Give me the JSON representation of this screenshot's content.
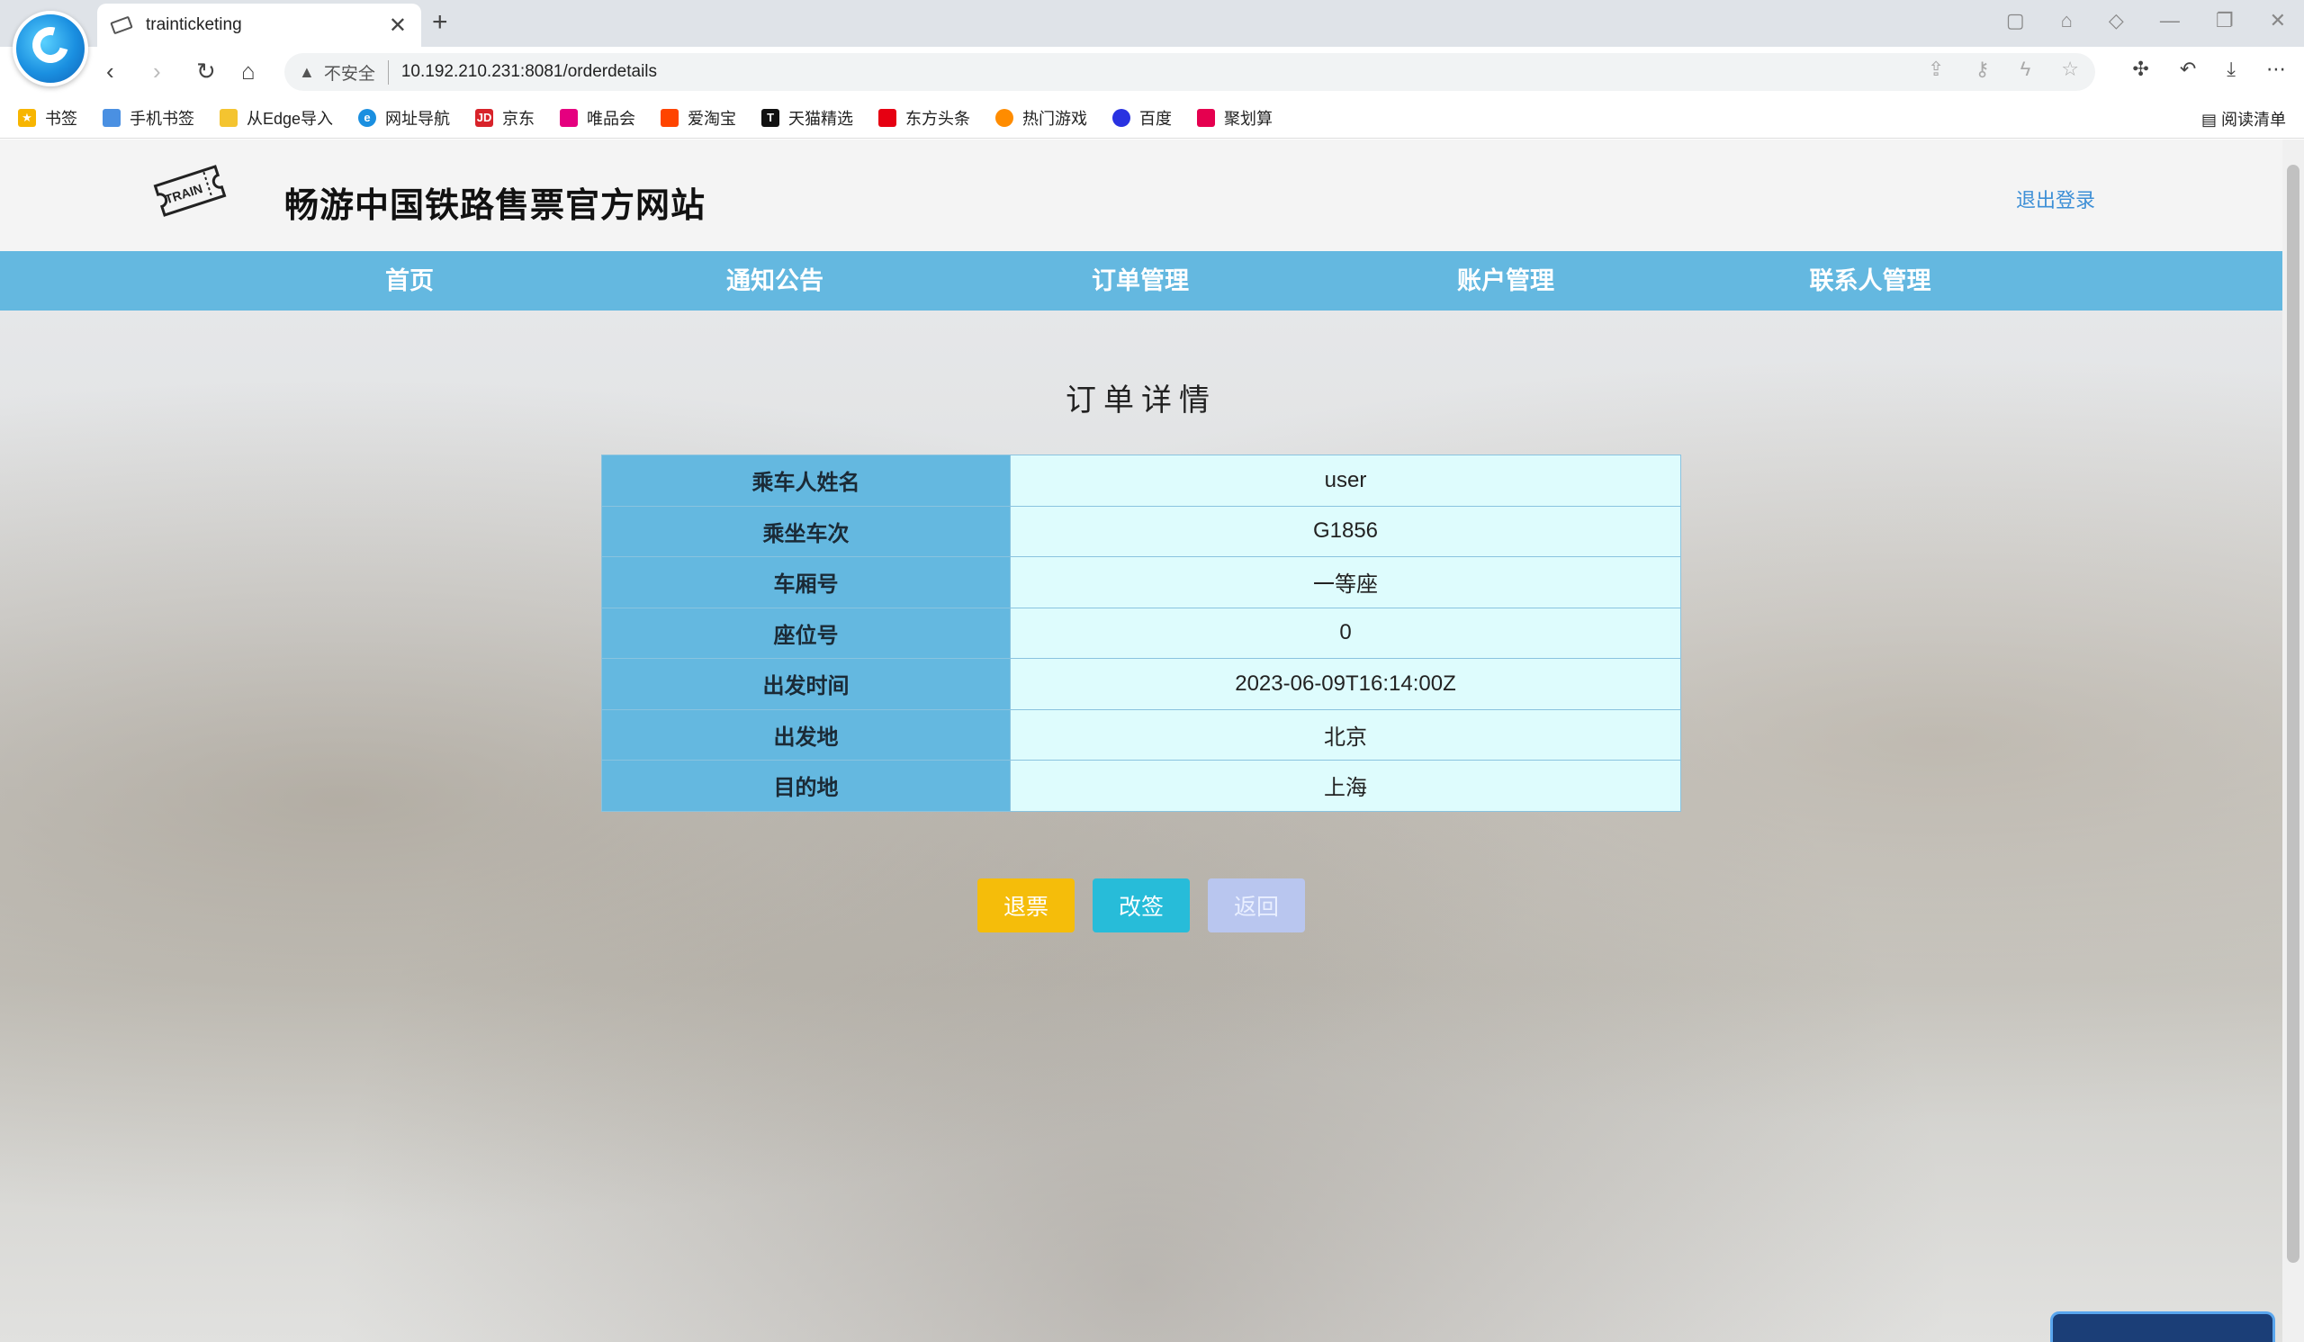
{
  "browser": {
    "tab_title": "trainticketing",
    "tab_close": "✕",
    "new_tab": "+",
    "insecure_label": "不安全",
    "url": "10.192.210.231:8081/orderdetails",
    "bookmarks": [
      {
        "label": "书签",
        "icon": "star-icon",
        "color": "#f7b500"
      },
      {
        "label": "手机书签",
        "icon": "phone-icon",
        "color": "#4a90e2"
      },
      {
        "label": "从Edge导入",
        "icon": "folder-icon",
        "color": "#f4c430"
      },
      {
        "label": "网址导航",
        "icon": "browser-e-icon",
        "color": "#1a8fe0"
      },
      {
        "label": "京东",
        "icon": "jd-icon",
        "color": "#d8232a"
      },
      {
        "label": "唯品会",
        "icon": "vip-icon",
        "color": "#e5007f"
      },
      {
        "label": "爱淘宝",
        "icon": "taobao-icon",
        "color": "#ff4400"
      },
      {
        "label": "天猫精选",
        "icon": "tmall-icon",
        "color": "#111111"
      },
      {
        "label": "东方头条",
        "icon": "news-icon",
        "color": "#e60012"
      },
      {
        "label": "热门游戏",
        "icon": "game-icon",
        "color": "#ff8c00"
      },
      {
        "label": "百度",
        "icon": "baidu-icon",
        "color": "#2932e1"
      },
      {
        "label": "聚划算",
        "icon": "juhuasuan-icon",
        "color": "#e5004f"
      }
    ],
    "reader_label": "阅读清单"
  },
  "site": {
    "title": "畅游中国铁路售票官方网站",
    "logout": "退出登录",
    "logo_text": "TRAIN",
    "nav": [
      "首页",
      "通知公告",
      "订单管理",
      "账户管理",
      "联系人管理"
    ]
  },
  "order": {
    "title": "订单详情",
    "rows": [
      {
        "label": "乘车人姓名",
        "value": "user"
      },
      {
        "label": "乘坐车次",
        "value": "G1856"
      },
      {
        "label": "车厢号",
        "value": "一等座"
      },
      {
        "label": "座位号",
        "value": "0"
      },
      {
        "label": "出发时间",
        "value": "2023-06-09T16:14:00Z"
      },
      {
        "label": "出发地",
        "value": "北京"
      },
      {
        "label": "目的地",
        "value": "上海"
      }
    ],
    "buttons": {
      "refund": "退票",
      "change": "改签",
      "back": "返回"
    }
  },
  "colors": {
    "nav_blue": "#64b8e0",
    "value_cell": "#defcfd",
    "refund": "#f5bd0a",
    "change": "#27bcd9",
    "back_disabled": "#b9c6ef",
    "link": "#3d8fd6"
  }
}
